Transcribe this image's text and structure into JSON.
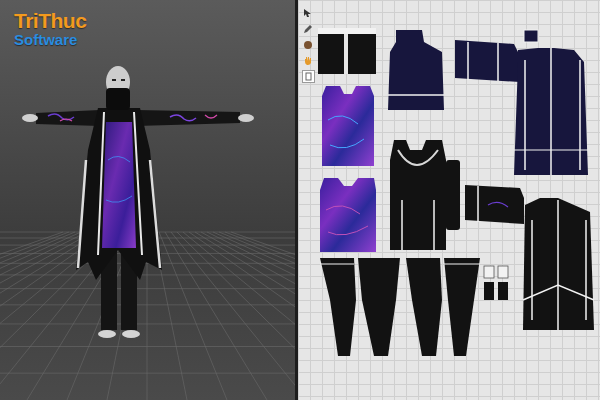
{
  "logo": {
    "brand": "TriThuc",
    "tagline": "Software"
  }
}
